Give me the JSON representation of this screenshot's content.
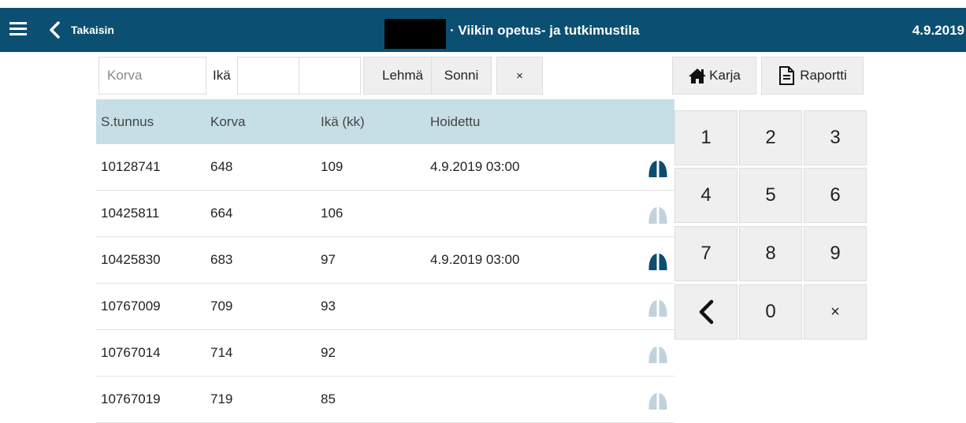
{
  "header": {
    "back_label": "Takaisin",
    "title": "· Viikin opetus- ja tutkimustila",
    "date": "4.9.2019"
  },
  "filters": {
    "korva_placeholder": "Korva",
    "ika_label": "Ikä",
    "ika_min_value": "",
    "ika_max_value": "",
    "lehma_label": "Lehmä",
    "sonni_label": "Sonni",
    "clear_label": "×"
  },
  "actions": {
    "karja_label": "Karja",
    "raportti_label": "Raportti"
  },
  "table": {
    "headers": [
      "S.tunnus",
      "Korva",
      "Ikä (kk)",
      "Hoidettu"
    ],
    "rows": [
      {
        "stunnus": "10128741",
        "korva": "648",
        "ika": "109",
        "hoidettu": "4.9.2019 03:00",
        "treated": true
      },
      {
        "stunnus": "10425811",
        "korva": "664",
        "ika": "106",
        "hoidettu": "",
        "treated": false
      },
      {
        "stunnus": "10425830",
        "korva": "683",
        "ika": "97",
        "hoidettu": "4.9.2019 03:00",
        "treated": true
      },
      {
        "stunnus": "10767009",
        "korva": "709",
        "ika": "93",
        "hoidettu": "",
        "treated": false
      },
      {
        "stunnus": "10767014",
        "korva": "714",
        "ika": "92",
        "hoidettu": "",
        "treated": false
      },
      {
        "stunnus": "10767019",
        "korva": "719",
        "ika": "85",
        "hoidettu": "",
        "treated": false
      }
    ]
  },
  "keypad": {
    "keys": [
      "1",
      "2",
      "3",
      "4",
      "5",
      "6",
      "7",
      "8",
      "9",
      "",
      "0",
      "×"
    ]
  },
  "colors": {
    "header_bg": "#0b4f72",
    "table_header_bg": "#c6dfe6",
    "hoof_treated": "#0d4d72",
    "hoof_untreated": "#c0d3dd"
  }
}
